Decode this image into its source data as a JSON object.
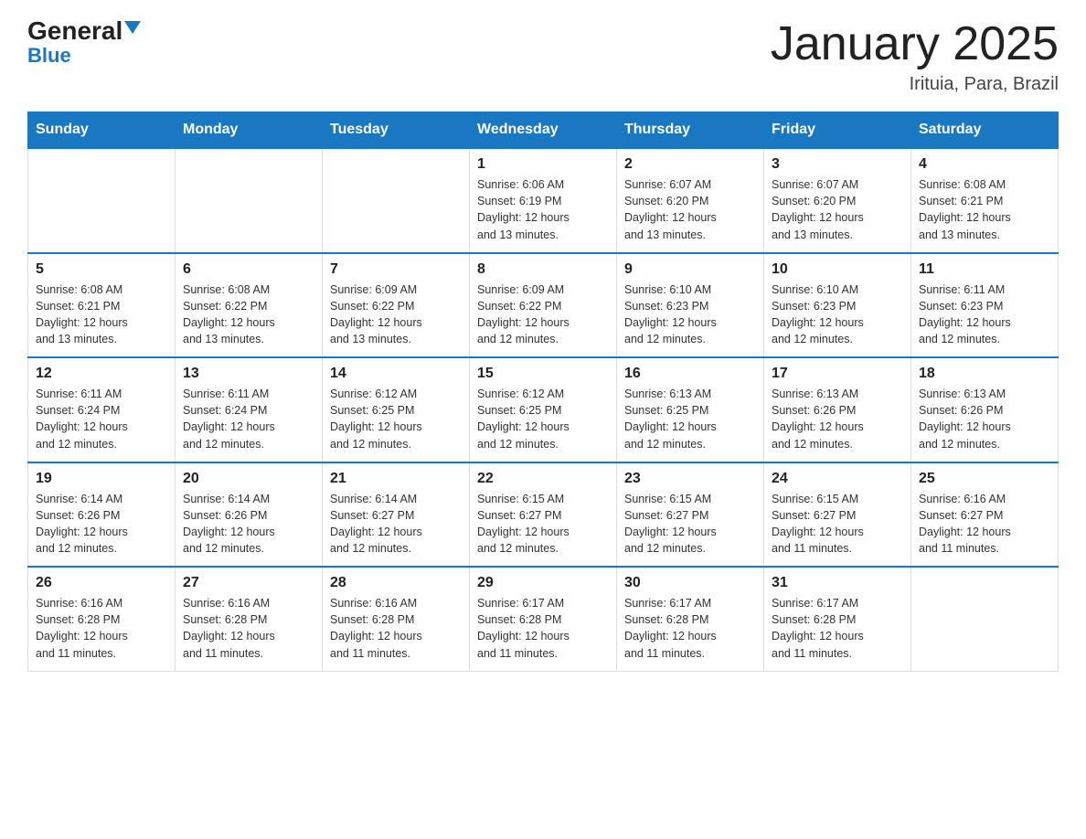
{
  "header": {
    "logo_general": "General",
    "logo_blue": "Blue",
    "month_title": "January 2025",
    "location": "Irituia, Para, Brazil"
  },
  "days_of_week": [
    "Sunday",
    "Monday",
    "Tuesday",
    "Wednesday",
    "Thursday",
    "Friday",
    "Saturday"
  ],
  "weeks": [
    [
      {
        "day": "",
        "info": ""
      },
      {
        "day": "",
        "info": ""
      },
      {
        "day": "",
        "info": ""
      },
      {
        "day": "1",
        "info": "Sunrise: 6:06 AM\nSunset: 6:19 PM\nDaylight: 12 hours\nand 13 minutes."
      },
      {
        "day": "2",
        "info": "Sunrise: 6:07 AM\nSunset: 6:20 PM\nDaylight: 12 hours\nand 13 minutes."
      },
      {
        "day": "3",
        "info": "Sunrise: 6:07 AM\nSunset: 6:20 PM\nDaylight: 12 hours\nand 13 minutes."
      },
      {
        "day": "4",
        "info": "Sunrise: 6:08 AM\nSunset: 6:21 PM\nDaylight: 12 hours\nand 13 minutes."
      }
    ],
    [
      {
        "day": "5",
        "info": "Sunrise: 6:08 AM\nSunset: 6:21 PM\nDaylight: 12 hours\nand 13 minutes."
      },
      {
        "day": "6",
        "info": "Sunrise: 6:08 AM\nSunset: 6:22 PM\nDaylight: 12 hours\nand 13 minutes."
      },
      {
        "day": "7",
        "info": "Sunrise: 6:09 AM\nSunset: 6:22 PM\nDaylight: 12 hours\nand 13 minutes."
      },
      {
        "day": "8",
        "info": "Sunrise: 6:09 AM\nSunset: 6:22 PM\nDaylight: 12 hours\nand 12 minutes."
      },
      {
        "day": "9",
        "info": "Sunrise: 6:10 AM\nSunset: 6:23 PM\nDaylight: 12 hours\nand 12 minutes."
      },
      {
        "day": "10",
        "info": "Sunrise: 6:10 AM\nSunset: 6:23 PM\nDaylight: 12 hours\nand 12 minutes."
      },
      {
        "day": "11",
        "info": "Sunrise: 6:11 AM\nSunset: 6:23 PM\nDaylight: 12 hours\nand 12 minutes."
      }
    ],
    [
      {
        "day": "12",
        "info": "Sunrise: 6:11 AM\nSunset: 6:24 PM\nDaylight: 12 hours\nand 12 minutes."
      },
      {
        "day": "13",
        "info": "Sunrise: 6:11 AM\nSunset: 6:24 PM\nDaylight: 12 hours\nand 12 minutes."
      },
      {
        "day": "14",
        "info": "Sunrise: 6:12 AM\nSunset: 6:25 PM\nDaylight: 12 hours\nand 12 minutes."
      },
      {
        "day": "15",
        "info": "Sunrise: 6:12 AM\nSunset: 6:25 PM\nDaylight: 12 hours\nand 12 minutes."
      },
      {
        "day": "16",
        "info": "Sunrise: 6:13 AM\nSunset: 6:25 PM\nDaylight: 12 hours\nand 12 minutes."
      },
      {
        "day": "17",
        "info": "Sunrise: 6:13 AM\nSunset: 6:26 PM\nDaylight: 12 hours\nand 12 minutes."
      },
      {
        "day": "18",
        "info": "Sunrise: 6:13 AM\nSunset: 6:26 PM\nDaylight: 12 hours\nand 12 minutes."
      }
    ],
    [
      {
        "day": "19",
        "info": "Sunrise: 6:14 AM\nSunset: 6:26 PM\nDaylight: 12 hours\nand 12 minutes."
      },
      {
        "day": "20",
        "info": "Sunrise: 6:14 AM\nSunset: 6:26 PM\nDaylight: 12 hours\nand 12 minutes."
      },
      {
        "day": "21",
        "info": "Sunrise: 6:14 AM\nSunset: 6:27 PM\nDaylight: 12 hours\nand 12 minutes."
      },
      {
        "day": "22",
        "info": "Sunrise: 6:15 AM\nSunset: 6:27 PM\nDaylight: 12 hours\nand 12 minutes."
      },
      {
        "day": "23",
        "info": "Sunrise: 6:15 AM\nSunset: 6:27 PM\nDaylight: 12 hours\nand 12 minutes."
      },
      {
        "day": "24",
        "info": "Sunrise: 6:15 AM\nSunset: 6:27 PM\nDaylight: 12 hours\nand 11 minutes."
      },
      {
        "day": "25",
        "info": "Sunrise: 6:16 AM\nSunset: 6:27 PM\nDaylight: 12 hours\nand 11 minutes."
      }
    ],
    [
      {
        "day": "26",
        "info": "Sunrise: 6:16 AM\nSunset: 6:28 PM\nDaylight: 12 hours\nand 11 minutes."
      },
      {
        "day": "27",
        "info": "Sunrise: 6:16 AM\nSunset: 6:28 PM\nDaylight: 12 hours\nand 11 minutes."
      },
      {
        "day": "28",
        "info": "Sunrise: 6:16 AM\nSunset: 6:28 PM\nDaylight: 12 hours\nand 11 minutes."
      },
      {
        "day": "29",
        "info": "Sunrise: 6:17 AM\nSunset: 6:28 PM\nDaylight: 12 hours\nand 11 minutes."
      },
      {
        "day": "30",
        "info": "Sunrise: 6:17 AM\nSunset: 6:28 PM\nDaylight: 12 hours\nand 11 minutes."
      },
      {
        "day": "31",
        "info": "Sunrise: 6:17 AM\nSunset: 6:28 PM\nDaylight: 12 hours\nand 11 minutes."
      },
      {
        "day": "",
        "info": ""
      }
    ]
  ]
}
